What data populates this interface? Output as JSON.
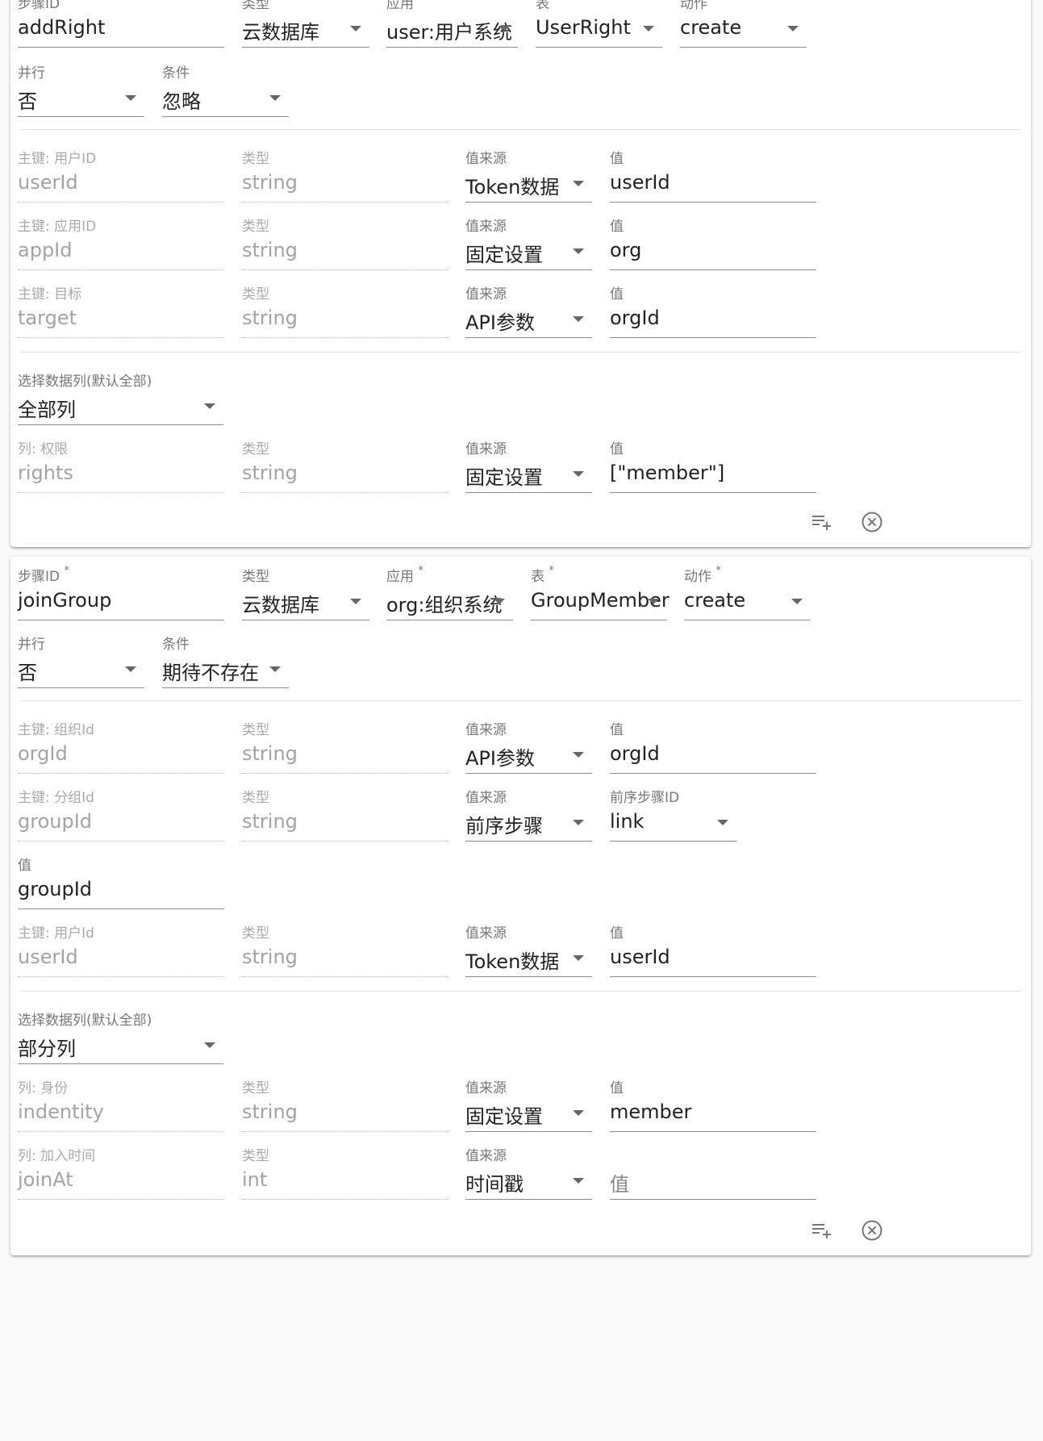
{
  "step1": {
    "header": {
      "step_id": {
        "label": "步骤ID",
        "value": "addRight"
      },
      "type": {
        "label": "类型",
        "value": "云数据库"
      },
      "app": {
        "label": "应用",
        "value": "user:用户系统"
      },
      "table": {
        "label": "表",
        "value": "UserRight"
      },
      "action": {
        "label": "动作",
        "value": "create"
      },
      "parallel": {
        "label": "并行",
        "value": "否"
      },
      "condition": {
        "label": "条件",
        "value": "忽略"
      }
    },
    "keys": [
      {
        "key_label": "主键: 用户ID",
        "key_value": "userId",
        "type_label": "类型",
        "type_value": "string",
        "source_label": "值来源",
        "source_value": "Token数据",
        "value_label": "值",
        "value_value": "userId"
      },
      {
        "key_label": "主键: 应用ID",
        "key_value": "appId",
        "type_label": "类型",
        "type_value": "string",
        "source_label": "值来源",
        "source_value": "固定设置",
        "value_label": "值",
        "value_value": "org"
      },
      {
        "key_label": "主键: 目标",
        "key_value": "target",
        "type_label": "类型",
        "type_value": "string",
        "source_label": "值来源",
        "source_value": "API参数",
        "value_label": "值",
        "value_value": "orgId"
      }
    ],
    "column_select": {
      "label": "选择数据列(默认全部)",
      "value": "全部列"
    },
    "columns": [
      {
        "col_label": "列: 权限",
        "col_value": "rights",
        "type_label": "类型",
        "type_value": "string",
        "source_label": "值来源",
        "source_value": "固定设置",
        "value_label": "值",
        "value_value": "[\"member\"]"
      }
    ]
  },
  "step2": {
    "header": {
      "step_id": {
        "label": "步骤ID",
        "value": "joinGroup"
      },
      "type": {
        "label": "类型",
        "value": "云数据库"
      },
      "app": {
        "label": "应用",
        "value": "org:组织系统"
      },
      "table": {
        "label": "表",
        "value": "GroupMember"
      },
      "action": {
        "label": "动作",
        "value": "create"
      },
      "parallel": {
        "label": "并行",
        "value": "否"
      },
      "condition": {
        "label": "条件",
        "value": "期待不存在"
      }
    },
    "keys": [
      {
        "key_label": "主键: 组织Id",
        "key_value": "orgId",
        "type_label": "类型",
        "type_value": "string",
        "source_label": "值来源",
        "source_value": "API参数",
        "value_label": "值",
        "value_value": "orgId"
      },
      {
        "key_label": "主键: 分组Id",
        "key_value": "groupId",
        "type_label": "类型",
        "type_value": "string",
        "source_label": "值来源",
        "source_value": "前序步骤",
        "prev_label": "前序步骤ID",
        "prev_value": "link",
        "value_label": "值",
        "value_value": "groupId"
      },
      {
        "key_label": "主键: 用户Id",
        "key_value": "userId",
        "type_label": "类型",
        "type_value": "string",
        "source_label": "值来源",
        "source_value": "Token数据",
        "value_label": "值",
        "value_value": "userId"
      }
    ],
    "column_select": {
      "label": "选择数据列(默认全部)",
      "value": "部分列"
    },
    "columns": [
      {
        "col_label": "列: 身份",
        "col_value": "indentity",
        "type_label": "类型",
        "type_value": "string",
        "source_label": "值来源",
        "source_value": "固定设置",
        "value_label": "值",
        "value_value": "member"
      },
      {
        "col_label": "列: 加入时间",
        "col_value": "joinAt",
        "type_label": "类型",
        "type_value": "int",
        "source_label": "值来源",
        "source_value": "时间戳",
        "value_label": "",
        "value_placeholder": "值"
      }
    ]
  },
  "required_mark": "*",
  "icons": {
    "add_row": "playlist-add-icon",
    "remove": "close-circle-icon"
  },
  "colors": {
    "label": "#777777",
    "text": "#222222",
    "disabled_text": "#a3a3a3",
    "card": "#ffffff",
    "background": "#fafafa"
  }
}
